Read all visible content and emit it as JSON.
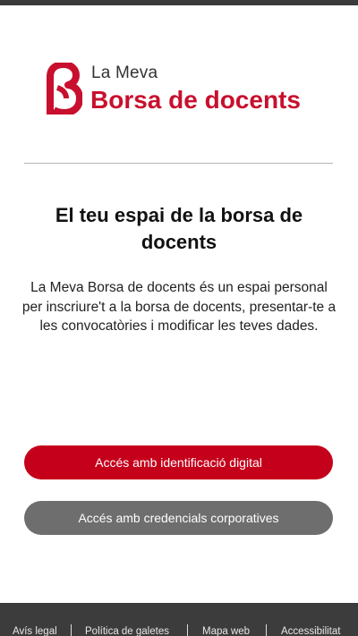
{
  "brand": {
    "small_text": "La Meva",
    "big_text": "Borsa de docents",
    "accent_color": "#c8102e",
    "logo_icon": "beta-b-logo-icon"
  },
  "main": {
    "title": "El teu espai de la borsa de docents",
    "description": "La Meva Borsa de docents és un espai personal per inscriure't a la borsa de docents, presentar-te a les convocatòries i modificar les teves dades."
  },
  "buttons": {
    "digital_label": "Accés amb identificació digital",
    "digital_color": "#c5001b",
    "corporate_label": "Accés amb credencials corporatives",
    "corporate_color": "#6e6e6e"
  },
  "footer": {
    "links": [
      "Avís legal",
      "Política de galetes",
      "Mapa web",
      "Accessibilitat"
    ]
  }
}
